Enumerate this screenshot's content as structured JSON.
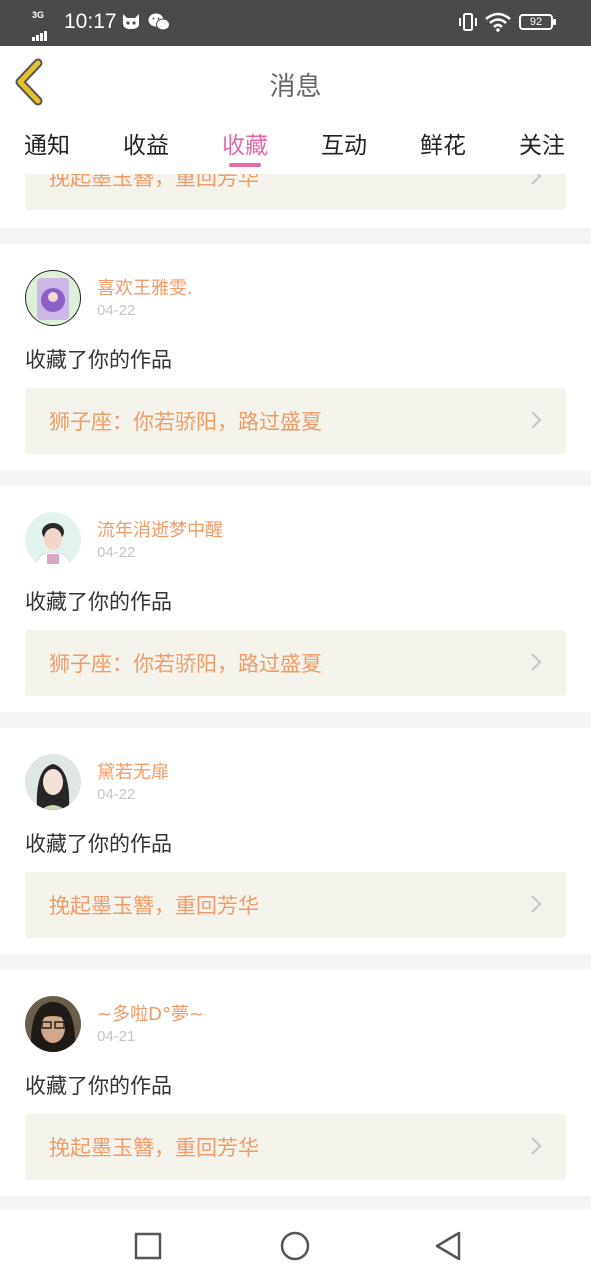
{
  "status_bar": {
    "network": "3G",
    "time": "10:17",
    "battery": "92",
    "icons": [
      "signal-icon",
      "cat-icon",
      "wechat-icon",
      "vibrate-icon",
      "wifi-icon",
      "battery-icon"
    ]
  },
  "header": {
    "title": "消息",
    "back_icon": "chevron-left-icon",
    "accent_color": "#e5c12a"
  },
  "tabs": [
    {
      "label": "通知",
      "active": false
    },
    {
      "label": "收益",
      "active": false
    },
    {
      "label": "收藏",
      "active": true
    },
    {
      "label": "互动",
      "active": false
    },
    {
      "label": "鲜花",
      "active": false
    },
    {
      "label": "关注",
      "active": false
    }
  ],
  "partial_top_card": {
    "work_title": "挽起墨玉簪，重回芳华"
  },
  "messages": [
    {
      "user": "喜欢王雅雯.",
      "date": "04-22",
      "action": "收藏了你的作品",
      "work_title": "狮子座：你若骄阳，路过盛夏"
    },
    {
      "user": "流年消逝梦中醒",
      "date": "04-22",
      "action": "收藏了你的作品",
      "work_title": "狮子座：你若骄阳，路过盛夏"
    },
    {
      "user": "黛若无扉",
      "date": "04-22",
      "action": "收藏了你的作品",
      "work_title": "挽起墨玉簪，重回芳华"
    },
    {
      "user": "~多啦D°夢~",
      "date": "04-21",
      "action": "收藏了你的作品",
      "work_title": "挽起墨玉簪，重回芳华"
    }
  ],
  "colors": {
    "active_tab": "#e46aa8",
    "username": "#ef9c69",
    "work_link_bg": "#f5f4ec",
    "status_bar_bg": "#4a4a4a"
  },
  "nav_bar": {
    "icons": [
      "square-recents-icon",
      "circle-home-icon",
      "triangle-back-icon"
    ]
  }
}
